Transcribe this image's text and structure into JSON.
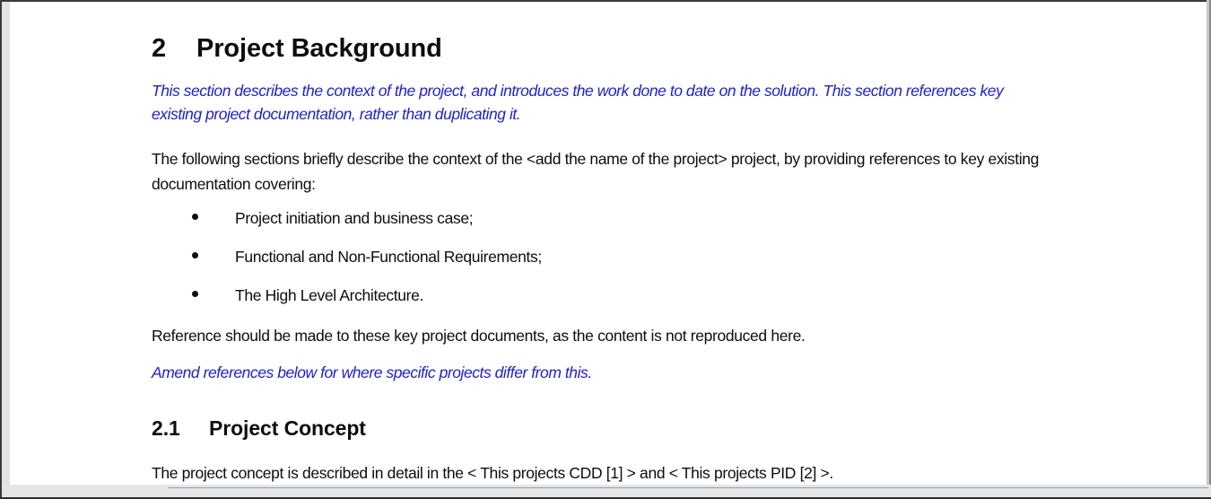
{
  "document": {
    "heading_1": {
      "number": "2",
      "title": "Project Background"
    },
    "guidance_1": "This section describes the context of the project, and introduces the work done to date on the solution.  This section references key existing project documentation, rather than duplicating it.",
    "paragraph_1": "The following sections briefly describe the context of the <add the name of the project> project, by providing references to key existing documentation covering:",
    "bullets": [
      "Project initiation and business case;",
      "Functional and Non-Functional Requirements;",
      "The High Level Architecture."
    ],
    "paragraph_2": "Reference should be made to these key project documents, as the content is not reproduced here.",
    "guidance_2": "Amend references below for where specific projects differ from this.",
    "heading_2": {
      "number": "2.1",
      "title": "Project Concept"
    },
    "paragraph_3": "The project concept is described in detail in the < This projects CDD [1] > and < This projects PID [2] >."
  },
  "colors": {
    "guidance_text": "#2222C4",
    "body_text": "#0D0D0D",
    "page_background": "#FFFFFF",
    "frame": "#3A3A3A",
    "gutter": "#E2E4E6"
  }
}
